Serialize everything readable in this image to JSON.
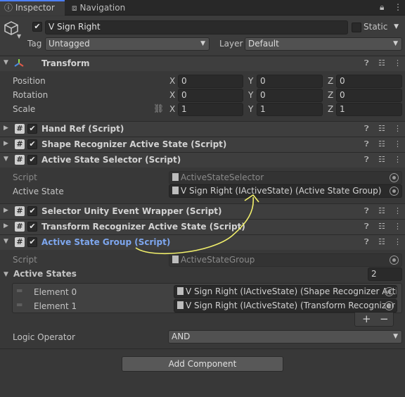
{
  "tabs": {
    "inspector": "Inspector",
    "navigation": "Navigation"
  },
  "gameobject": {
    "name": "V Sign Right",
    "static_label": "Static",
    "tag_label": "Tag",
    "tag_value": "Untagged",
    "layer_label": "Layer",
    "layer_value": "Default"
  },
  "transform": {
    "title": "Transform",
    "position_label": "Position",
    "rotation_label": "Rotation",
    "scale_label": "Scale",
    "x": "X",
    "y": "Y",
    "z": "Z",
    "position": [
      "0",
      "0",
      "0"
    ],
    "rotation": [
      "0",
      "0",
      "0"
    ],
    "scale": [
      "1",
      "1",
      "1"
    ]
  },
  "components": {
    "hand_ref": "Hand Ref (Script)",
    "shape_recognizer": "Shape Recognizer Active State (Script)",
    "active_state_selector": "Active State Selector (Script)",
    "selector_event_wrapper": "Selector Unity Event Wrapper (Script)",
    "transform_recognizer": "Transform Recognizer Active State (Script)",
    "active_state_group": "Active State Group (Script)"
  },
  "selector": {
    "script_label": "Script",
    "script_value": "ActiveStateSelector",
    "active_state_label": "Active State",
    "active_state_value": "V Sign Right (IActiveState) (Active State Group)"
  },
  "group": {
    "script_label": "Script",
    "script_value": "ActiveStateGroup",
    "active_states_label": "Active States",
    "count": "2",
    "elements": [
      {
        "label": "Element 0",
        "value": "V Sign Right (IActiveState) (Shape Recognizer Acti"
      },
      {
        "label": "Element 1",
        "value": "V Sign Right (IActiveState) (Transform Recognizer"
      }
    ],
    "plus": "+",
    "minus": "−",
    "logic_label": "Logic Operator",
    "logic_value": "AND"
  },
  "add_component": "Add Component",
  "colors": {
    "accent_title": "#7ea7ef",
    "annotation": "#f1ef6b"
  }
}
